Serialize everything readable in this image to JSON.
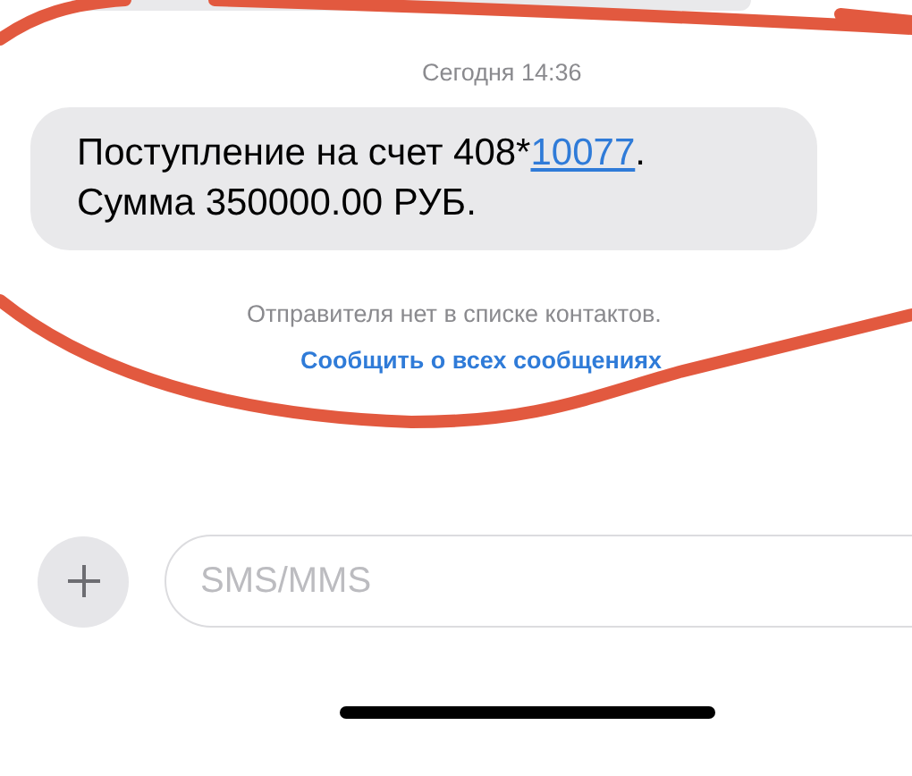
{
  "timestamp": "Сегодня 14:36",
  "message": {
    "text": "Поступление на счет 408*",
    "link": "10077",
    "after": ".",
    "line_2": "Сумма 350000.00 РУБ."
  },
  "notice": {
    "text": "Отправителя нет в списке контактов.",
    "link": "Сообщить о всех сообщениях"
  },
  "composer": {
    "placeholder": "SMS/MMS"
  }
}
